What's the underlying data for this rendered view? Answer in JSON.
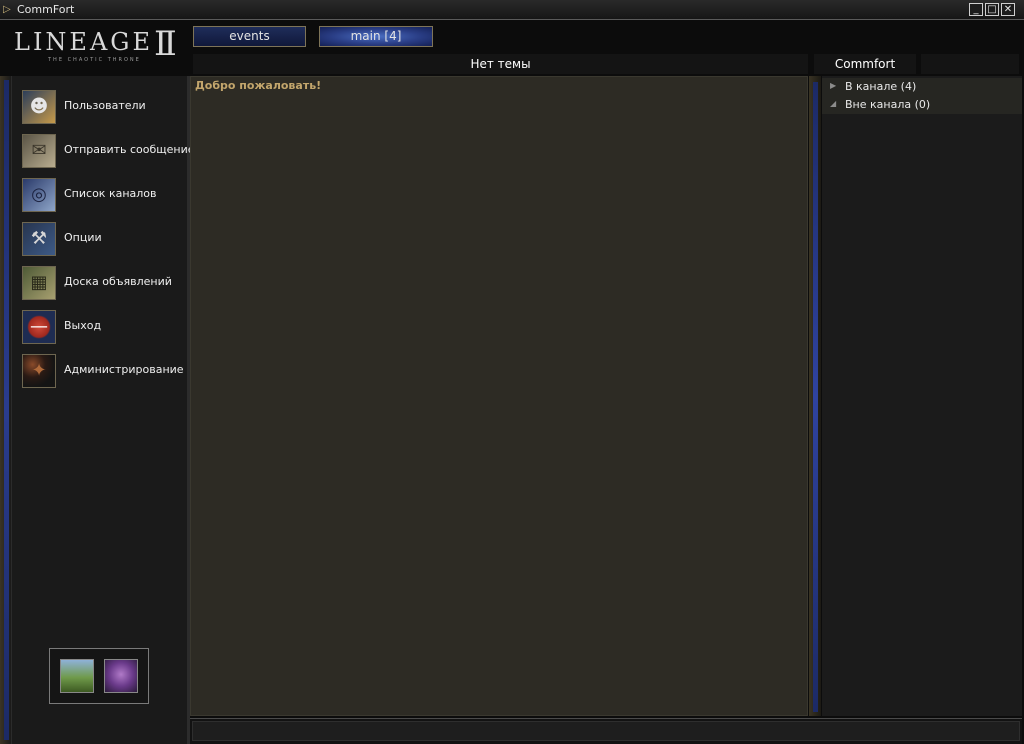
{
  "window": {
    "title": "CommFort",
    "minimize_icon": "minimize-icon",
    "maximize_icon": "maximize-icon",
    "close_icon": "close-icon"
  },
  "logo": {
    "text": "LINEAGE",
    "mark": "II",
    "subtitle": "THE CHAOTIC THRONE"
  },
  "tabs": [
    {
      "label": "events",
      "active": false
    },
    {
      "label": "main [4]",
      "active": true
    }
  ],
  "topic": {
    "text": "Нет темы"
  },
  "nick_header": {
    "text": "Commfort"
  },
  "menu": [
    {
      "label": "Пользователи",
      "icon": "user-portrait-icon"
    },
    {
      "label": "Отправить сообщение",
      "icon": "message-letter-icon"
    },
    {
      "label": "Список каналов",
      "icon": "channel-list-icon"
    },
    {
      "label": "Опции",
      "icon": "hammer-options-icon"
    },
    {
      "label": "Доска объявлений",
      "icon": "bulletin-board-icon"
    },
    {
      "label": "Выход",
      "icon": "exit-icon"
    },
    {
      "label": "Администрирование",
      "icon": "admin-wand-icon"
    }
  ],
  "chat": {
    "welcome": "Добро пожаловать!"
  },
  "user_tree": [
    {
      "label": "В канале (4)",
      "icon": "expand-arrow-icon"
    },
    {
      "label": "Вне канала (0)",
      "icon": "expand-arrow-icon"
    }
  ],
  "avatars": [
    {
      "icon": "landscape-avatar-icon"
    },
    {
      "icon": "creature-avatar-icon"
    }
  ],
  "input": {
    "value": ""
  },
  "colors": {
    "accent_blue": "#2a3e86",
    "welcome_text": "#c3a66c",
    "chat_bg": "#2d2b24",
    "frame_gold": "#7e7458"
  }
}
